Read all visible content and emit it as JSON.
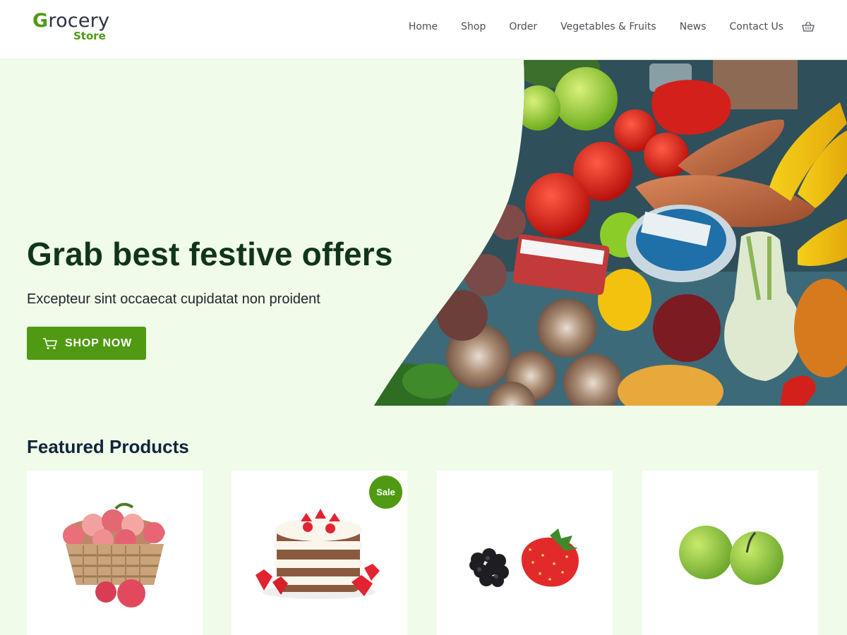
{
  "logo": {
    "first_letter": "G",
    "rest": "rocery",
    "sub": "Store"
  },
  "nav": {
    "items": [
      "Home",
      "Shop",
      "Order",
      "Vegetables & Fruits",
      "News",
      "Contact Us"
    ],
    "cart_icon": "basket-icon"
  },
  "hero": {
    "title": "Grab best festive offers",
    "subtitle": "Excepteur sint occaecat cupidatat non proident",
    "button_label": "SHOP NOW",
    "button_icon": "cart-icon",
    "image": "assorted-vegetables-and-fruits"
  },
  "featured": {
    "title": "Featured Products",
    "products": [
      {
        "image": "apple-basket",
        "badge": ""
      },
      {
        "image": "strawberry-cake",
        "badge": "Sale"
      },
      {
        "image": "blackberry-and-strawberry",
        "badge": ""
      },
      {
        "image": "green-apples",
        "badge": ""
      }
    ]
  },
  "colors": {
    "brand_green": "#4f9a12",
    "hero_bg": "#f0fbea",
    "title_dark": "#10351a"
  }
}
